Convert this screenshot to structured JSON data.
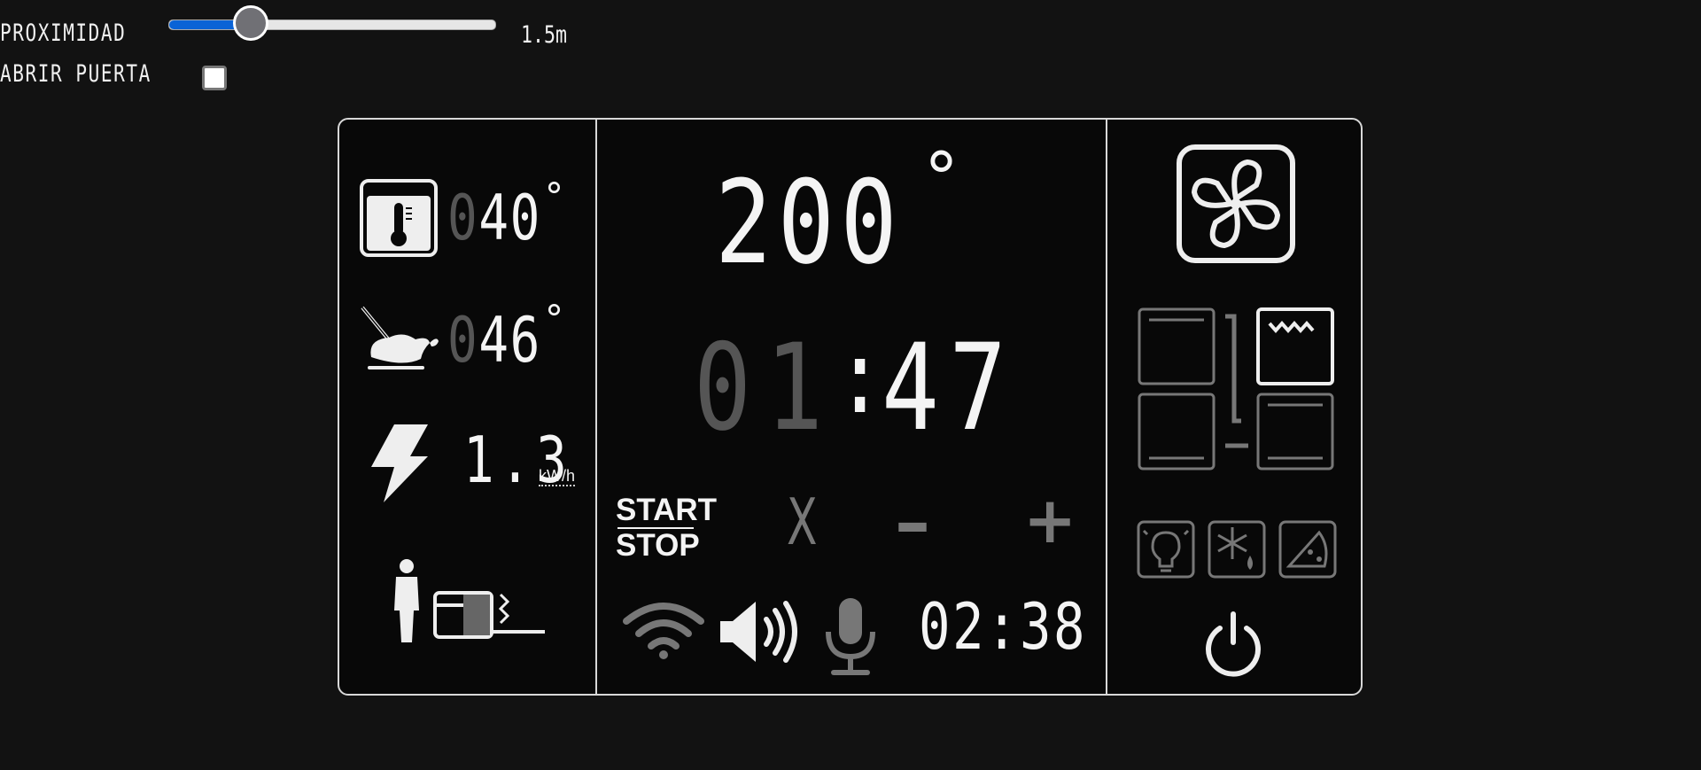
{
  "controls": {
    "proximity_label": "PROXIMIDAD",
    "proximity_value": "1.5m",
    "proximity_level": 0.25,
    "open_door_label": "ABRIR PUERTA",
    "open_door_checked": false,
    "accent_color": "#0a63d6"
  },
  "left": {
    "oven_temp_dim": "0",
    "oven_temp": "40",
    "oven_temp_unit": "°",
    "probe_temp_dim": "0",
    "probe_temp": "46",
    "probe_temp_unit": "°",
    "energy_value": "1.3",
    "energy_unit": "kW/h",
    "icons": [
      "oven-thermometer-icon",
      "chicken-probe-icon",
      "lightning-icon",
      "person-near-oven-icon"
    ]
  },
  "center": {
    "set_temp": "200",
    "set_temp_unit": "°",
    "timer_hours": "01",
    "timer_separator": ":",
    "timer_minutes": "47",
    "start_label": "START",
    "stop_label": "STOP",
    "clock": "02:38",
    "icons": [
      "wifi-icon",
      "speaker-icon",
      "microphone-icon",
      "cancel-icon",
      "minus-icon",
      "plus-icon"
    ]
  },
  "right": {
    "icons": [
      "fan-icon",
      "heating-mode-icons",
      "light-icon",
      "defrost-icon",
      "pizza-icon",
      "power-icon"
    ]
  }
}
